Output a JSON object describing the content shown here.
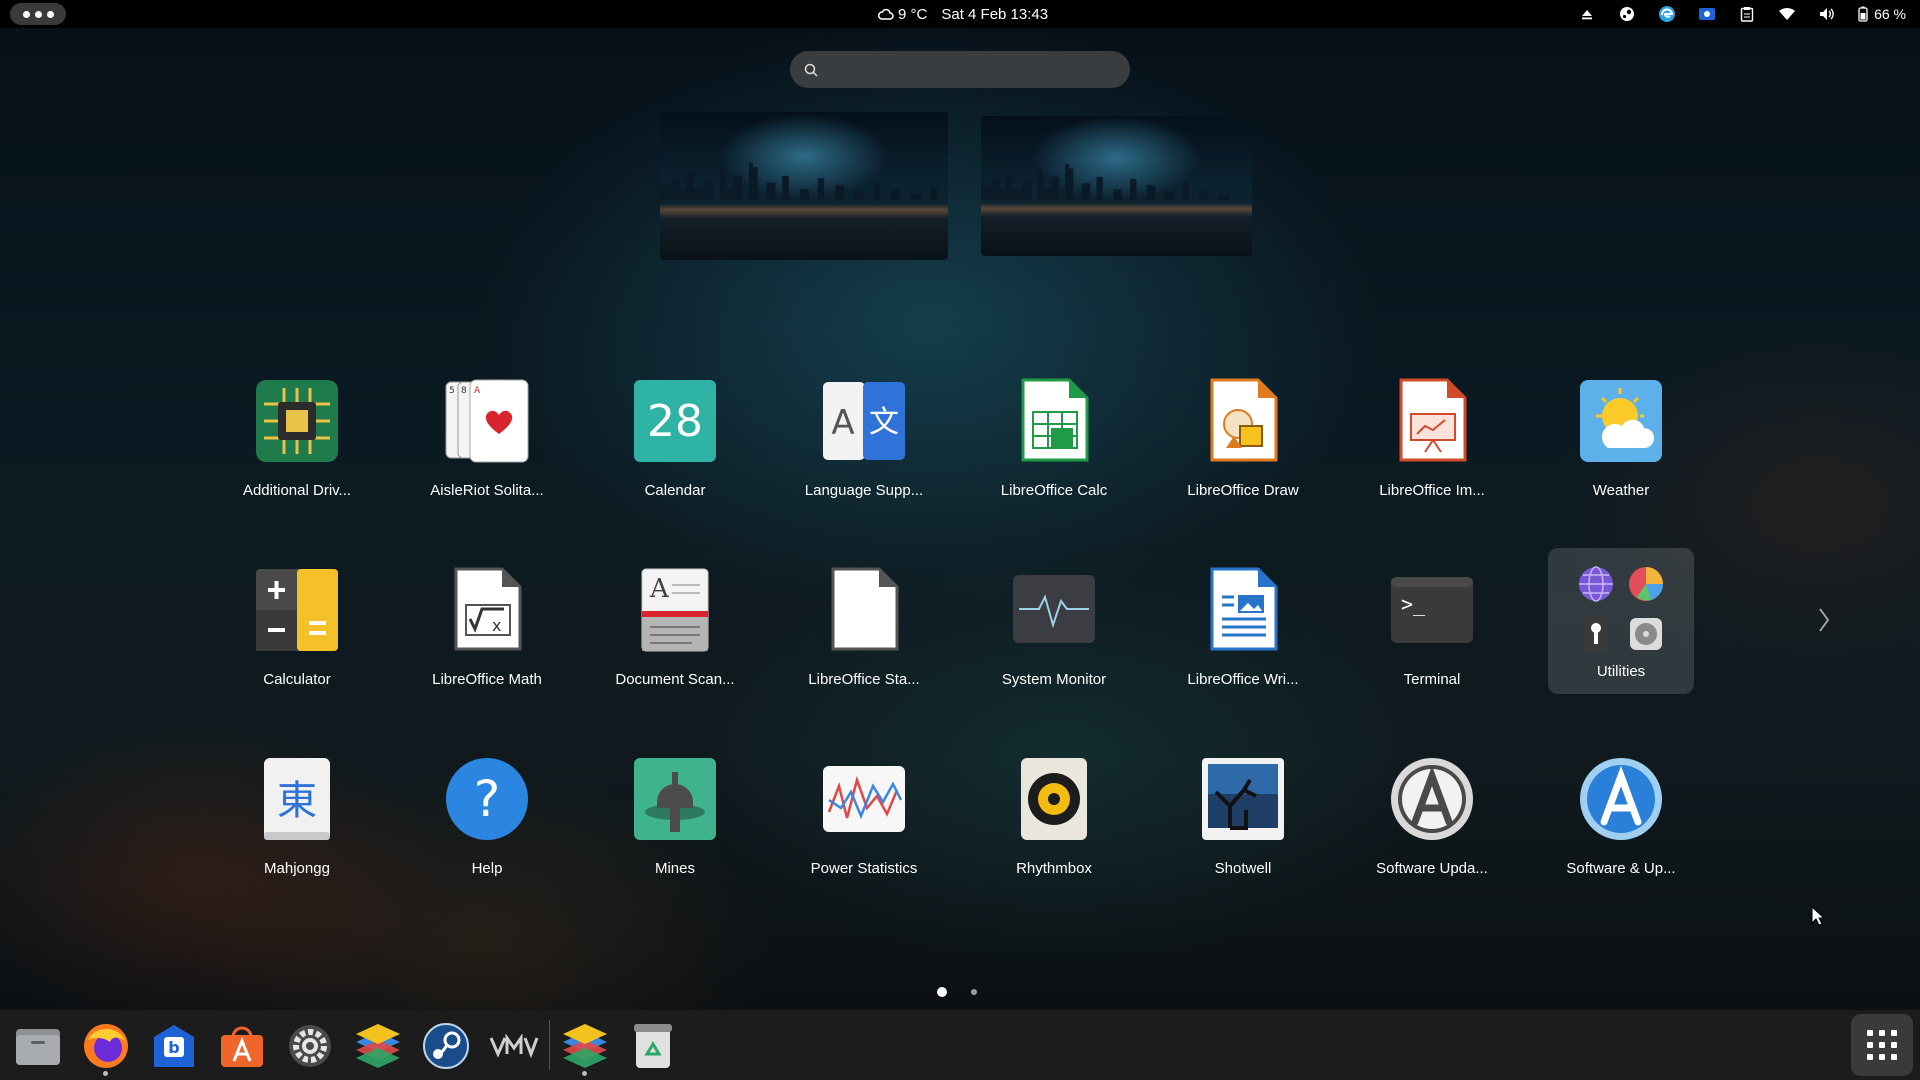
{
  "topbar": {
    "weather": "9 °C",
    "datetime": "Sat 4 Feb  13:43",
    "battery": "66 %"
  },
  "search": {
    "placeholder": "",
    "value": ""
  },
  "apps": [
    {
      "label": "Additional Driv...",
      "icon": "chip-icon"
    },
    {
      "label": "AisleRiot Solita...",
      "icon": "cards-icon"
    },
    {
      "label": "Calendar",
      "icon": "calendar-icon",
      "day": "28"
    },
    {
      "label": "Language Supp...",
      "icon": "language-icon"
    },
    {
      "label": "LibreOffice Calc",
      "icon": "calc-icon"
    },
    {
      "label": "LibreOffice Draw",
      "icon": "draw-icon"
    },
    {
      "label": "LibreOffice Im...",
      "icon": "impress-icon"
    },
    {
      "label": "Weather",
      "icon": "weather-icon"
    },
    {
      "label": "Calculator",
      "icon": "calculator-icon"
    },
    {
      "label": "LibreOffice Math",
      "icon": "math-icon"
    },
    {
      "label": "Document Scan...",
      "icon": "scanner-icon"
    },
    {
      "label": "LibreOffice Sta...",
      "icon": "start-center-icon"
    },
    {
      "label": "System Monitor",
      "icon": "system-monitor-icon"
    },
    {
      "label": "LibreOffice Wri...",
      "icon": "writer-icon"
    },
    {
      "label": "Terminal",
      "icon": "terminal-icon"
    },
    {
      "label": "Mahjongg",
      "icon": "mahjongg-icon",
      "glyph": "東"
    },
    {
      "label": "Help",
      "icon": "help-icon"
    },
    {
      "label": "Mines",
      "icon": "mines-icon"
    },
    {
      "label": "Power Statistics",
      "icon": "power-statistics-icon"
    },
    {
      "label": "Rhythmbox",
      "icon": "rhythmbox-icon"
    },
    {
      "label": "Shotwell",
      "icon": "shotwell-icon"
    },
    {
      "label": "Software Upda...",
      "icon": "software-updater-icon"
    },
    {
      "label": "Software & Up...",
      "icon": "software-updates-icon"
    }
  ],
  "folder": {
    "label": "Utilities"
  },
  "dock": [
    {
      "name": "files",
      "running": false
    },
    {
      "name": "firefox",
      "running": true
    },
    {
      "name": "bitwarden",
      "running": false
    },
    {
      "name": "app-center",
      "running": false
    },
    {
      "name": "settings",
      "running": false
    },
    {
      "name": "layers",
      "running": false
    },
    {
      "name": "steam",
      "running": false
    },
    {
      "name": "vm",
      "running": false
    },
    {
      "name": "layers-2",
      "running": true
    },
    {
      "name": "trash",
      "running": false
    }
  ],
  "colors": {
    "topbar": "#000000",
    "dock": "#1c1c1c",
    "folder_bg": "rgba(255,255,255,0.14)"
  }
}
